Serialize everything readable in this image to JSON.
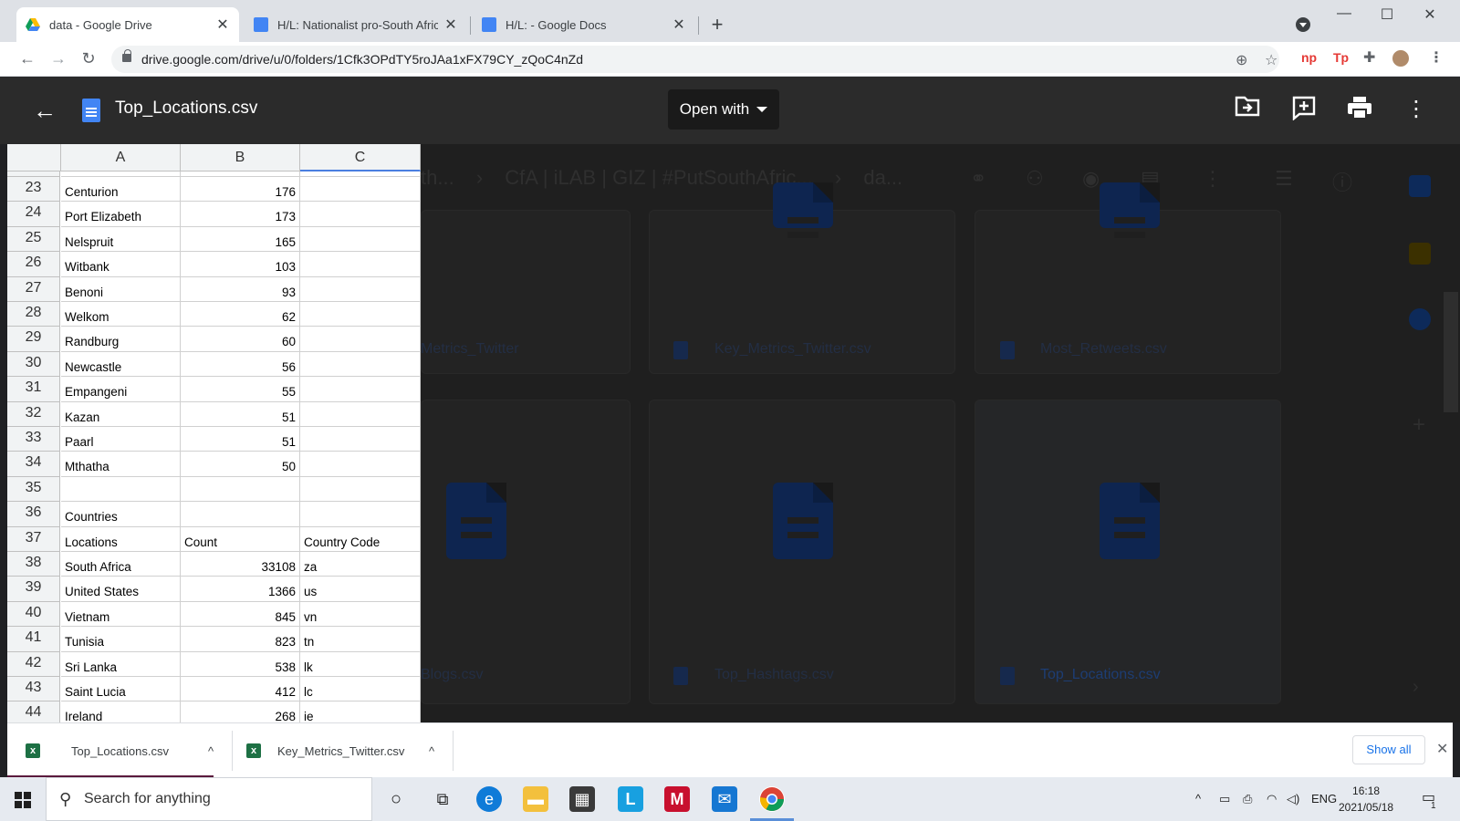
{
  "browser": {
    "tabs": [
      {
        "title": "data - Google Drive",
        "icon": "google-drive-icon",
        "active": true
      },
      {
        "title": "H/L: Nationalist pro-South Africa",
        "icon": "google-docs-icon",
        "active": false
      },
      {
        "title": "H/L: - Google Docs",
        "icon": "google-docs-icon",
        "active": false
      }
    ],
    "url": "drive.google.com/drive/u/0/folders/1Cfk3OPdTY5roJAa1xFX79CY_zQoC4nZd"
  },
  "viewer": {
    "file_title": "Top_Locations.csv",
    "open_with_label": "Open with"
  },
  "drive_background": {
    "breadcrumb_1": "th...",
    "breadcrumb_2": "CfA | iLAB | GIZ | #PutSouthAfric...",
    "breadcrumb_3": "da...",
    "files": [
      "Metrics_Twitter",
      "Key_Metrics_Twitter.csv",
      "Most_Retweets.csv",
      "Blogs.csv",
      "Top_Hashtags.csv",
      "Top_Locations.csv"
    ]
  },
  "sheet": {
    "columns": [
      "A",
      "B",
      "C"
    ],
    "rows": [
      {
        "num": "23",
        "a": "Centurion",
        "b": "176",
        "c": ""
      },
      {
        "num": "24",
        "a": "Port Elizabeth",
        "b": "173",
        "c": ""
      },
      {
        "num": "25",
        "a": "Nelspruit",
        "b": "165",
        "c": ""
      },
      {
        "num": "26",
        "a": "Witbank",
        "b": "103",
        "c": ""
      },
      {
        "num": "27",
        "a": "Benoni",
        "b": "93",
        "c": ""
      },
      {
        "num": "28",
        "a": "Welkom",
        "b": "62",
        "c": ""
      },
      {
        "num": "29",
        "a": "Randburg",
        "b": "60",
        "c": ""
      },
      {
        "num": "30",
        "a": "Newcastle",
        "b": "56",
        "c": ""
      },
      {
        "num": "31",
        "a": "Empangeni",
        "b": "55",
        "c": ""
      },
      {
        "num": "32",
        "a": "Kazan",
        "b": "51",
        "c": ""
      },
      {
        "num": "33",
        "a": "Paarl",
        "b": "51",
        "c": ""
      },
      {
        "num": "34",
        "a": "Mthatha",
        "b": "50",
        "c": ""
      },
      {
        "num": "35",
        "a": "",
        "b": "",
        "c": ""
      },
      {
        "num": "36",
        "a": "Countries",
        "b": "",
        "c": ""
      },
      {
        "num": "37",
        "a": "Locations",
        "b": "Count",
        "c": "Country Code"
      },
      {
        "num": "38",
        "a": "South Africa",
        "b": "33108",
        "c": "za"
      },
      {
        "num": "39",
        "a": "United States",
        "b": "1366",
        "c": "us"
      },
      {
        "num": "40",
        "a": "Vietnam",
        "b": "845",
        "c": "vn"
      },
      {
        "num": "41",
        "a": "Tunisia",
        "b": "823",
        "c": "tn"
      },
      {
        "num": "42",
        "a": "Sri Lanka",
        "b": "538",
        "c": "lk"
      },
      {
        "num": "43",
        "a": "Saint Lucia",
        "b": "412",
        "c": "lc"
      },
      {
        "num": "44",
        "a": "Ireland",
        "b": "268",
        "c": "ie"
      }
    ]
  },
  "downloads": {
    "items": [
      "Top_Locations.csv",
      "Key_Metrics_Twitter.csv"
    ],
    "show_all_label": "Show all"
  },
  "taskbar": {
    "search_placeholder": "Search for anything",
    "language": "ENG",
    "time": "16:18",
    "date": "2021/05/18",
    "notification_count": "1"
  },
  "colors": {
    "accent": "#4285f4",
    "header_bg": "#2b2b2b",
    "excel_green": "#1d7044"
  }
}
